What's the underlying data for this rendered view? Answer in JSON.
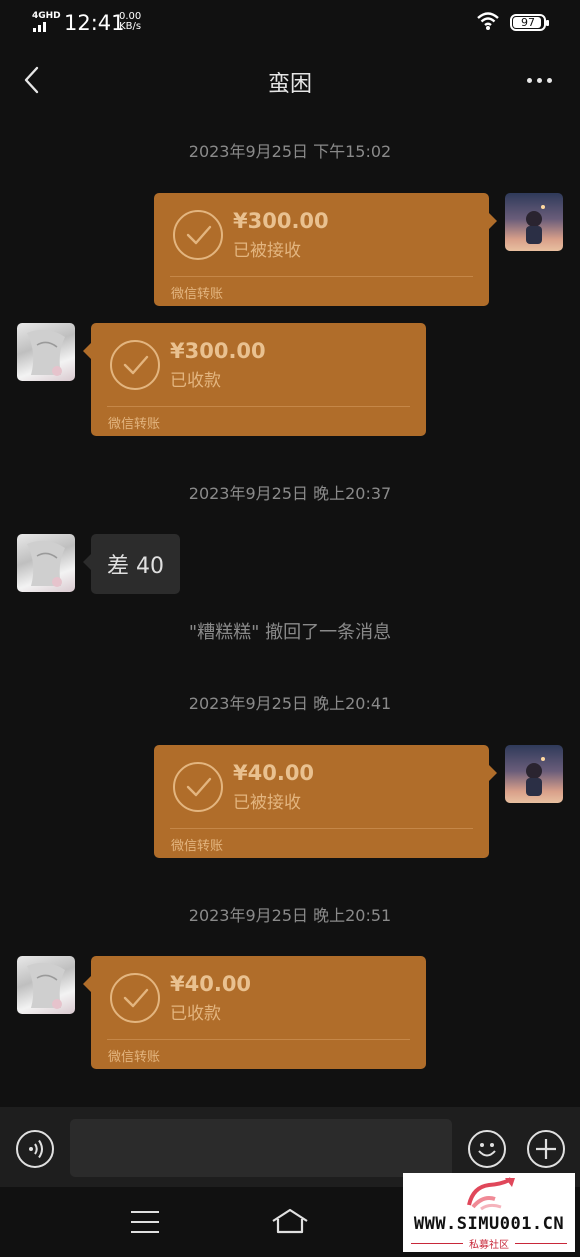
{
  "status_bar": {
    "network": "4GHD",
    "time": "12:41",
    "speed_value": "0.00",
    "speed_unit": "KB/s",
    "battery": "97"
  },
  "header": {
    "title": "蛮困",
    "back_icon": "back-chevron-icon",
    "more_icon": "more-dots-icon"
  },
  "messages": [
    {
      "type": "timestamp",
      "text": "2023年9月25日 下午15:02"
    },
    {
      "type": "transfer",
      "side": "right",
      "amount": "¥300.00",
      "status": "已被接收",
      "footer": "微信转账"
    },
    {
      "type": "transfer",
      "side": "left",
      "amount": "¥300.00",
      "status": "已收款",
      "footer": "微信转账"
    },
    {
      "type": "timestamp",
      "text": "2023年9月25日 晚上20:37"
    },
    {
      "type": "text",
      "side": "left",
      "text": "差 40"
    },
    {
      "type": "system",
      "text": "\"糟糕糕\" 撤回了一条消息"
    },
    {
      "type": "timestamp",
      "text": "2023年9月25日 晚上20:41"
    },
    {
      "type": "transfer",
      "side": "right",
      "amount": "¥40.00",
      "status": "已被接收",
      "footer": "微信转账"
    },
    {
      "type": "timestamp",
      "text": "2023年9月25日 晚上20:51"
    },
    {
      "type": "transfer",
      "side": "left",
      "amount": "¥40.00",
      "status": "已收款",
      "footer": "微信转账"
    }
  ],
  "input_bar": {
    "value": "",
    "voice_icon": "voice-icon",
    "emoji_icon": "emoji-icon",
    "plus_icon": "plus-icon"
  },
  "nav": {
    "menu_icon": "menu-icon",
    "home_icon": "home-icon"
  },
  "watermark": {
    "url": "WWW.SIMU001.CN",
    "sub": "私募社区"
  },
  "colors": {
    "background": "#111111",
    "transfer_card": "#b06d2a",
    "transfer_text": "#e3b57f",
    "timestamp": "#8a8a8a"
  }
}
